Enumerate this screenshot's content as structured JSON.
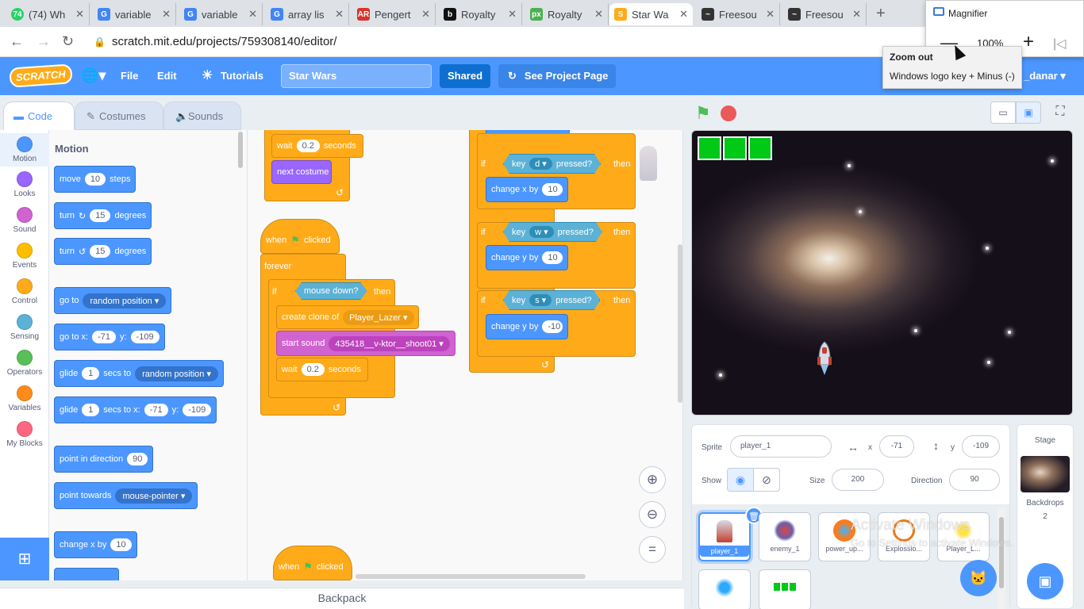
{
  "browser": {
    "tabs": [
      {
        "label": "(74) Wh",
        "icon": "whatsapp-icon",
        "color": "#25d366",
        "fav": "74"
      },
      {
        "label": "variable",
        "icon": "google-icon",
        "color": "#4285f4",
        "fav": "G"
      },
      {
        "label": "variable",
        "icon": "google-icon",
        "color": "#4285f4",
        "fav": "G"
      },
      {
        "label": "array lis",
        "icon": "google-icon",
        "color": "#4285f4",
        "fav": "G"
      },
      {
        "label": "Pengert",
        "icon": "ar-icon",
        "color": "#d9342b",
        "fav": "AR"
      },
      {
        "label": "Royalty",
        "icon": "b-icon",
        "color": "#111111",
        "fav": "b"
      },
      {
        "label": "Royalty",
        "icon": "px-icon",
        "color": "#4cb050",
        "fav": "px"
      },
      {
        "label": "Star Wa",
        "icon": "scratch-icon",
        "color": "#ffab19",
        "fav": "S"
      },
      {
        "label": "Freesou",
        "icon": "waveform-icon",
        "color": "#333333",
        "fav": "~"
      },
      {
        "label": "Freesou",
        "icon": "waveform-icon",
        "color": "#333333",
        "fav": "~"
      }
    ],
    "url": "scratch.mit.edu/projects/759308140/editor/"
  },
  "magnifier": {
    "title": "Magnifier",
    "zoom": "100%",
    "tooltip_title": "Zoom out",
    "tooltip_shortcut": "Windows logo key + Minus (-)"
  },
  "menubar": {
    "logo": "SCRATCH",
    "file": "File",
    "edit": "Edit",
    "tutorials": "Tutorials",
    "project_title": "Star Wars",
    "shared": "Shared",
    "see_project": "See Project Page",
    "username": "_danar"
  },
  "editor_tabs": {
    "code": "Code",
    "costumes": "Costumes",
    "sounds": "Sounds"
  },
  "categories": [
    {
      "label": "Motion",
      "color": "#4c97ff"
    },
    {
      "label": "Looks",
      "color": "#9966ff"
    },
    {
      "label": "Sound",
      "color": "#cf63cf"
    },
    {
      "label": "Events",
      "color": "#ffbf00"
    },
    {
      "label": "Control",
      "color": "#ffab19"
    },
    {
      "label": "Sensing",
      "color": "#5cb1d6"
    },
    {
      "label": "Operators",
      "color": "#59c059"
    },
    {
      "label": "Variables",
      "color": "#ff8c1a"
    },
    {
      "label": "My Blocks",
      "color": "#ff6680"
    }
  ],
  "palette": {
    "heading": "Motion",
    "move": {
      "text": "move",
      "steps": "10",
      "suffix": "steps"
    },
    "turn_right": {
      "text": "turn",
      "deg": "15",
      "suffix": "degrees"
    },
    "turn_left": {
      "text": "turn",
      "deg": "15",
      "suffix": "degrees"
    },
    "goto": {
      "text": "go to",
      "target": "random position"
    },
    "goto_xy": {
      "text": "go to x:",
      "x": "-71",
      "y_label": "y:",
      "y": "-109"
    },
    "glide_to": {
      "text": "glide",
      "secs": "1",
      "mid": "secs to",
      "target": "random position"
    },
    "glide_xy": {
      "text": "glide",
      "secs": "1",
      "mid": "secs to x:",
      "x": "-71",
      "y_label": "y:",
      "y": "-109"
    },
    "point_dir": {
      "text": "point in direction",
      "val": "90"
    },
    "point_towards": {
      "text": "point towards",
      "target": "mouse-pointer"
    },
    "change_x": {
      "text": "change x by",
      "val": "10"
    }
  },
  "script": {
    "wait1": {
      "text": "wait",
      "val": "0.2",
      "suffix": "seconds"
    },
    "next_costume": "next costume",
    "when_flag": {
      "text": "when",
      "suffix": "clicked"
    },
    "forever": "forever",
    "if_mouse": {
      "if": "if",
      "cond": "mouse down?",
      "then": "then"
    },
    "create_clone": {
      "text": "create clone of",
      "target": "Player_Lazer"
    },
    "start_sound": {
      "text": "start sound",
      "sound": "435418__v-ktor__shoot01"
    },
    "wait2": {
      "text": "wait",
      "val": "0.2",
      "suffix": "seconds"
    },
    "when_flag2": {
      "text": "when",
      "suffix": "clicked"
    },
    "if_d": {
      "if": "if",
      "key": "key",
      "k": "d",
      "pressed": "pressed?",
      "then": "then"
    },
    "change_x": {
      "text": "change x by",
      "val": "10"
    },
    "if_w": {
      "if": "if",
      "key": "key",
      "k": "w",
      "pressed": "pressed?",
      "then": "then"
    },
    "change_y1": {
      "text": "change y by",
      "val": "10"
    },
    "if_s": {
      "if": "if",
      "key": "key",
      "k": "s",
      "pressed": "pressed?",
      "then": "then"
    },
    "change_y2": {
      "text": "change y by",
      "val": "-10"
    }
  },
  "backpack": "Backpack",
  "sprite_info": {
    "sprite_label": "Sprite",
    "sprite_name": "player_1",
    "x_label": "x",
    "x": "-71",
    "y_label": "y",
    "y": "-109",
    "show_label": "Show",
    "size_label": "Size",
    "size": "200",
    "direction_label": "Direction",
    "direction": "90"
  },
  "sprites": [
    {
      "name": "player_1",
      "selected": true
    },
    {
      "name": "enemy_1"
    },
    {
      "name": "power_up..."
    },
    {
      "name": "Explossio..."
    },
    {
      "name": "Player_L..."
    },
    {
      "name": ""
    },
    {
      "name": ""
    }
  ],
  "stage_pane": {
    "label": "Stage",
    "backdrops_label": "Backdrops",
    "backdrops_count": "2"
  },
  "watermark": {
    "line1": "Activate Windows",
    "line2": "Go to Settings to activate Windows."
  },
  "colors": {
    "scratch_blue": "#4c97ff",
    "control_orange": "#ffab19",
    "life_green": "#00c917"
  }
}
